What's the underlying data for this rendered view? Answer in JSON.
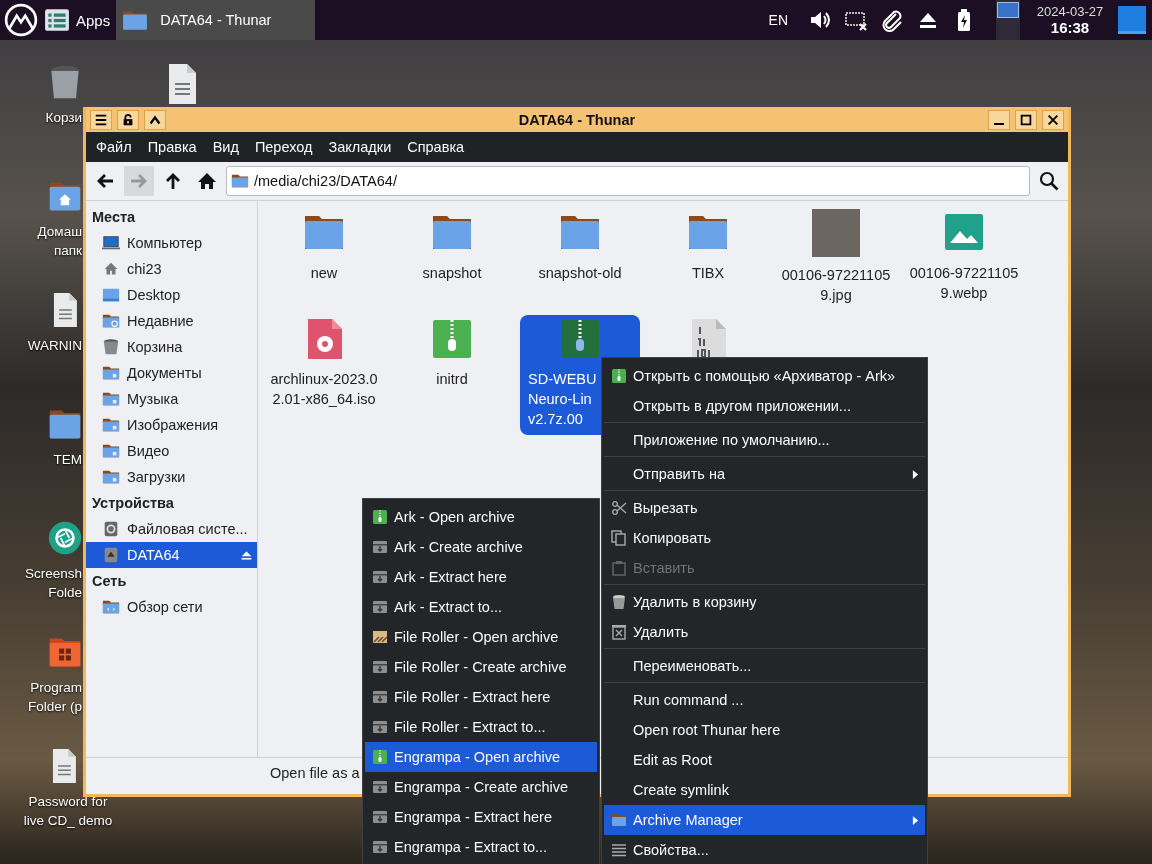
{
  "panel": {
    "apps_label": "Apps",
    "tasks": [
      {
        "title": "DATA64 - Thunar",
        "selected": true
      }
    ],
    "layout": "EN",
    "date": "2024-03-27",
    "time": "16:38"
  },
  "desktop": {
    "columns": [
      [
        {
          "kind": "trash",
          "lines": [
            "Корзи"
          ]
        },
        {
          "kind": "home",
          "lines": [
            "Домаш",
            "папк"
          ]
        },
        {
          "kind": "document",
          "lines": [
            "WARNIN"
          ]
        },
        {
          "kind": "folder",
          "lines": [
            "TEM"
          ]
        },
        {
          "kind": "screenshot",
          "lines": [
            "Screensh",
            "Folde"
          ]
        },
        {
          "kind": "program",
          "lines": [
            "Program",
            "Folder (p"
          ]
        },
        {
          "kind": "document",
          "lines": [
            "Password for",
            "live CD_ demo"
          ]
        }
      ],
      [
        {
          "kind": "document"
        }
      ]
    ]
  },
  "window": {
    "title": "DATA64 - Thunar",
    "menu": [
      "Файл",
      "Правка",
      "Вид",
      "Переход",
      "Закладки",
      "Справка"
    ],
    "toolbar": [
      {
        "kind": "back",
        "disabled": false
      },
      {
        "kind": "forward",
        "disabled": true
      },
      {
        "kind": "up",
        "disabled": false
      },
      {
        "kind": "home",
        "disabled": false
      }
    ],
    "path": "/media/chi23/DATA64/",
    "sidebar": [
      {
        "heading": "Места",
        "items": [
          {
            "kind": "computer",
            "label": "Компьютер",
            "selected": false
          },
          {
            "kind": "home",
            "label": "chi23",
            "selected": false
          },
          {
            "kind": "desktop",
            "label": "Desktop",
            "selected": false
          },
          {
            "kind": "recent",
            "label": "Недавние",
            "selected": false
          },
          {
            "kind": "trash",
            "label": "Корзина",
            "selected": false
          },
          {
            "kind": "folder",
            "label": "Документы",
            "selected": false
          },
          {
            "kind": "folder",
            "label": "Музыка",
            "selected": false
          },
          {
            "kind": "folder",
            "label": "Изображения",
            "selected": false
          },
          {
            "kind": "folder",
            "label": "Видео",
            "selected": false
          },
          {
            "kind": "folder",
            "label": "Загрузки",
            "selected": false
          }
        ]
      },
      {
        "heading": "Устройства",
        "items": [
          {
            "kind": "drive",
            "label": "Файловая систе...",
            "selected": false
          },
          {
            "kind": "removable",
            "label": "DATA64",
            "selected": true
          }
        ]
      },
      {
        "heading": "Сеть",
        "items": [
          {
            "kind": "network",
            "label": "Обзор сети",
            "selected": false
          }
        ]
      }
    ],
    "files": [
      {
        "kind": "folder",
        "lines": [
          "new"
        ],
        "selected": false
      },
      {
        "kind": "folder",
        "lines": [
          "snapshot"
        ],
        "selected": false
      },
      {
        "kind": "folder",
        "lines": [
          "snapshot-old"
        ],
        "selected": false
      },
      {
        "kind": "folder",
        "lines": [
          "TIBX"
        ],
        "selected": false
      },
      {
        "kind": "photo",
        "lines": [
          "00106-97221105",
          "9.jpg"
        ],
        "selected": false
      },
      {
        "kind": "image",
        "lines": [
          "00106-97221105",
          "9.webp"
        ],
        "selected": false
      },
      {
        "kind": "disc",
        "lines": [
          "archlinux-2023.0",
          "2.01-x86_64.iso"
        ],
        "selected": false
      },
      {
        "kind": "archive",
        "lines": [
          "initrd"
        ],
        "selected": false
      },
      {
        "kind": "archive",
        "lines": [
          "SD-WEBU",
          "Neuro-Lin",
          "v2.7z.00"
        ],
        "selected": true
      },
      {
        "kind": "binary",
        "selected": false
      }
    ],
    "status": "Open file as a"
  },
  "context_menu": {
    "items": [
      {
        "kind": "ark",
        "label": "Открыть с помощью «Архиватор - Ark»",
        "selected": false,
        "disabled": false,
        "submenu": false
      },
      {
        "kind": "plain",
        "label": "Открыть в другом приложении...",
        "selected": false,
        "disabled": false,
        "submenu": false
      },
      {
        "kind": "separator"
      },
      {
        "kind": "plain",
        "label": "Приложение по умолчанию...",
        "selected": false,
        "disabled": false,
        "submenu": false
      },
      {
        "kind": "separator"
      },
      {
        "kind": "plain",
        "label": "Отправить на",
        "selected": false,
        "disabled": false,
        "submenu": true
      },
      {
        "kind": "separator"
      },
      {
        "kind": "cut",
        "label": "Вырезать",
        "selected": false,
        "disabled": false,
        "submenu": false
      },
      {
        "kind": "copy",
        "label": "Копировать",
        "selected": false,
        "disabled": false,
        "submenu": false
      },
      {
        "kind": "paste",
        "label": "Вставить",
        "selected": false,
        "disabled": true,
        "submenu": false
      },
      {
        "kind": "separator"
      },
      {
        "kind": "trash",
        "label": "Удалить в корзину",
        "selected": false,
        "disabled": false,
        "submenu": false
      },
      {
        "kind": "delete",
        "label": "Удалить",
        "selected": false,
        "disabled": false,
        "submenu": false
      },
      {
        "kind": "separator"
      },
      {
        "kind": "plain",
        "label": "Переименовать...",
        "selected": false,
        "disabled": false,
        "submenu": false
      },
      {
        "kind": "separator"
      },
      {
        "kind": "plain",
        "label": "Run command ...",
        "selected": false,
        "disabled": false,
        "submenu": false
      },
      {
        "kind": "plain",
        "label": "Open root Thunar here",
        "selected": false,
        "disabled": false,
        "submenu": false
      },
      {
        "kind": "plain",
        "label": "Edit as Root",
        "selected": false,
        "disabled": false,
        "submenu": false
      },
      {
        "kind": "plain",
        "label": "Create symlink",
        "selected": false,
        "disabled": false,
        "submenu": false
      },
      {
        "kind": "folder",
        "label": "Archive Manager",
        "selected": true,
        "disabled": false,
        "submenu": true
      },
      {
        "kind": "properties",
        "label": "Свойства...",
        "selected": false,
        "disabled": false,
        "submenu": false
      }
    ]
  },
  "submenu": {
    "items": [
      {
        "kind": "ark",
        "label": "Ark - Open archive",
        "selected": false
      },
      {
        "kind": "box",
        "label": "Ark - Create archive",
        "selected": false
      },
      {
        "kind": "box",
        "label": "Ark - Extract here",
        "selected": false
      },
      {
        "kind": "box",
        "label": "Ark - Extract to...",
        "selected": false
      },
      {
        "kind": "roller",
        "label": "File Roller - Open archive",
        "selected": false
      },
      {
        "kind": "box",
        "label": "File Roller - Create archive",
        "selected": false
      },
      {
        "kind": "box",
        "label": "File Roller - Extract here",
        "selected": false
      },
      {
        "kind": "box",
        "label": "File Roller - Extract to...",
        "selected": false
      },
      {
        "kind": "ark",
        "label": "Engrampa - Open archive",
        "selected": true
      },
      {
        "kind": "box",
        "label": "Engrampa - Create archive",
        "selected": false
      },
      {
        "kind": "box",
        "label": "Engrampa - Extract here",
        "selected": false
      },
      {
        "kind": "box",
        "label": "Engrampa - Extract to...",
        "selected": false
      }
    ]
  }
}
